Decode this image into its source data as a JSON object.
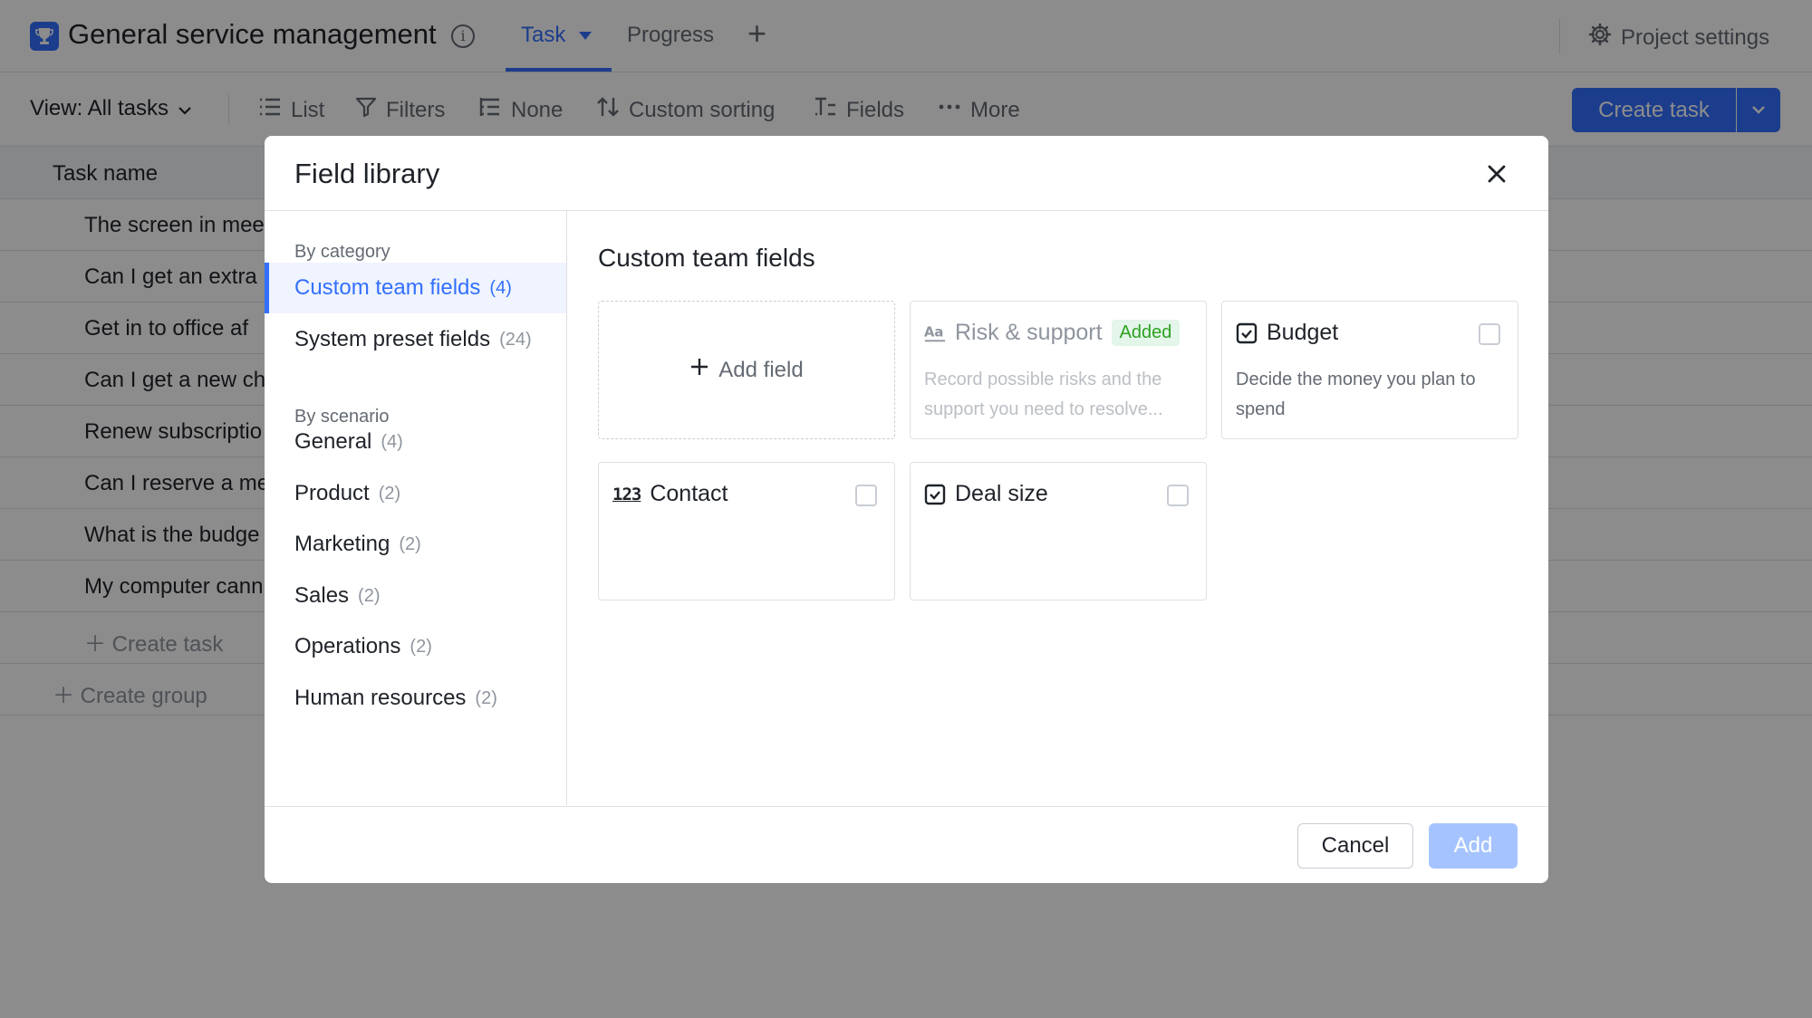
{
  "app": {
    "title": "General service management",
    "tabs": [
      {
        "label": "Task",
        "active": true
      },
      {
        "label": "Progress",
        "active": false
      }
    ],
    "add_tab_label": "+",
    "project_settings_label": "Project settings"
  },
  "toolbar": {
    "view_label": "View: All tasks",
    "list_label": "List",
    "filters_label": "Filters",
    "group_label": "None",
    "sorting_label": "Custom sorting",
    "fields_label": "Fields",
    "more_label": "More",
    "create_task_label": "Create task"
  },
  "table": {
    "column_task_name": "Task name",
    "rows": [
      "The screen in mee",
      "Can I get an extra",
      "Get in to office af",
      "Can I get a new ch",
      "Renew subscriptio",
      "Can I reserve a me",
      "What is the budge",
      "My computer cann"
    ],
    "create_task_label": "Create task",
    "create_group_label": "Create group"
  },
  "modal": {
    "title": "Field library",
    "by_category_label": "By category",
    "by_scenario_label": "By scenario",
    "categories": [
      {
        "label": "Custom team fields",
        "count": "(4)",
        "active": true
      },
      {
        "label": "System preset fields",
        "count": "(24)",
        "active": false
      }
    ],
    "scenarios": [
      {
        "label": "General",
        "count": "(4)"
      },
      {
        "label": "Product",
        "count": "(2)"
      },
      {
        "label": "Marketing",
        "count": "(2)"
      },
      {
        "label": "Sales",
        "count": "(2)"
      },
      {
        "label": "Operations",
        "count": "(2)"
      },
      {
        "label": "Human resources",
        "count": "(2)"
      }
    ],
    "section_title": "Custom team fields",
    "add_field_label": "Add field",
    "fields": [
      {
        "name": "Risk & support",
        "badge": "Added",
        "icon": "text-icon",
        "description_line1": "Record possible risks and the",
        "description_line2": "support you need to resolve...",
        "checked": false
      },
      {
        "name": "Budget",
        "icon": "checkbox-field-icon",
        "description_line1": "Decide the money you plan to",
        "description_line2": "spend",
        "checked": false
      },
      {
        "name": "Contact",
        "icon": "number-icon",
        "icon_text": "123",
        "checked": false
      },
      {
        "name": "Deal size",
        "icon": "checkbox-field-icon",
        "checked": false
      }
    ],
    "cancel_label": "Cancel",
    "add_label": "Add"
  },
  "colors": {
    "accent": "#3370ff",
    "added_badge_bg": "#e4f5ea",
    "added_badge_text": "#2ea121",
    "add_button_disabled": "#a5c4ff"
  }
}
